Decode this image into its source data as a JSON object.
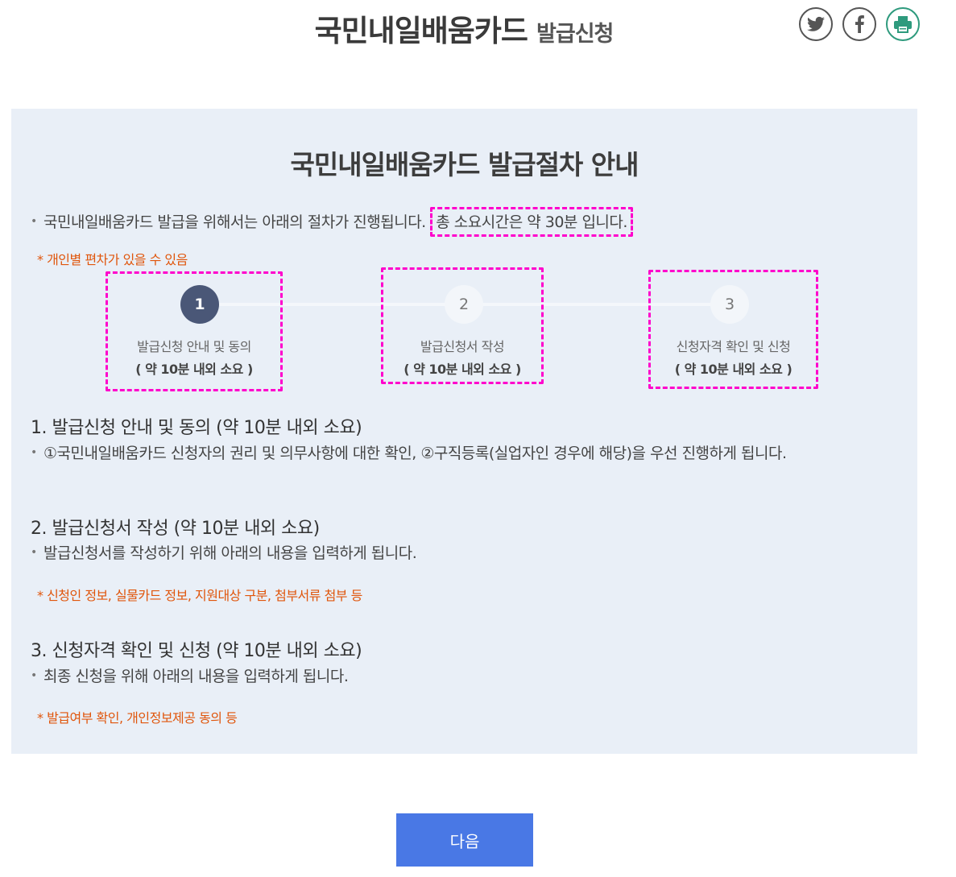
{
  "header": {
    "title_main": "국민내일배움카드",
    "title_sub": "발급신청",
    "share": [
      {
        "name": "twitter",
        "icon": "twitter-icon"
      },
      {
        "name": "facebook",
        "icon": "facebook-icon"
      },
      {
        "name": "print",
        "icon": "printer-icon"
      }
    ]
  },
  "guide": {
    "title": "국민내일배움카드 발급절차 안내",
    "intro_text": "국민내일배움카드 발급을 위해서는 아래의 절차가 진행됩니다.",
    "intro_highlight": "총 소요시간은 약 30분 입니다.",
    "note": "* 개인별 편차가 있을 수 있음",
    "steps": [
      {
        "number": "1",
        "label": "발급신청 안내 및 동의",
        "time": "( 약 10분 내외 소요 )",
        "active": true
      },
      {
        "number": "2",
        "label": "발급신청서 작성",
        "time": "( 약 10분 내외 소요 )",
        "active": false
      },
      {
        "number": "3",
        "label": "신청자격 확인 및 신청",
        "time": "( 약 10분 내외 소요 )",
        "active": false
      }
    ],
    "sections": [
      {
        "heading": "1. 발급신청 안내 및 동의 (약 10분 내외 소요)",
        "desc": "①국민내일배움카드 신청자의 권리 및 의무사항에 대한 확인, ②구직등록(실업자인 경우에 해당)을 우선 진행하게 됩니다.",
        "note": ""
      },
      {
        "heading": "2. 발급신청서 작성 (약 10분 내외 소요)",
        "desc": "발급신청서를 작성하기 위해 아래의 내용을 입력하게 됩니다.",
        "note": "* 신청인 정보, 실물카드 정보, 지원대상 구분, 첨부서류 첨부 등"
      },
      {
        "heading": "3. 신청자격 확인 및 신청 (약 10분 내외 소요)",
        "desc": "최종 신청을 위해 아래의 내용을 입력하게 됩니다.",
        "note": "* 발급여부 확인, 개인정보제공 동의 등"
      }
    ]
  },
  "next_button": "다음",
  "colors": {
    "box_bg": "#e9eff7",
    "active_step": "#4a5777",
    "note_orange": "#e0550b",
    "highlight_dash": "#ff00cc",
    "button_blue": "#4978e5"
  }
}
